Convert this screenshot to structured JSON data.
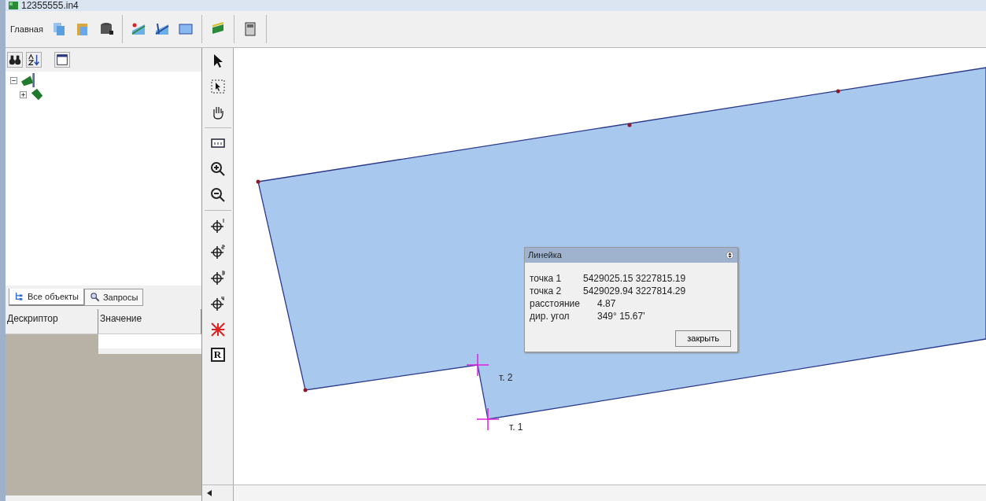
{
  "window": {
    "title": "12355555.in4"
  },
  "toolbar": {
    "label": "Главная"
  },
  "tree": [
    {
      "expanded": true,
      "children": [
        {
          "expanded": false
        }
      ]
    }
  ],
  "tabs": [
    {
      "label": "Все объекты",
      "selected": true
    },
    {
      "label": "Запросы",
      "selected": false
    }
  ],
  "properties": {
    "columns": [
      "Дескриптор",
      "Значение"
    ]
  },
  "tools": {
    "r_button": "R"
  },
  "map": {
    "point_labels": [
      "т. 2",
      "т. 1"
    ]
  },
  "ruler_dialog": {
    "title": "Линейка",
    "rows": [
      {
        "label": "точка 1",
        "value": "5429025.15 3227815.19"
      },
      {
        "label": "точка 2",
        "value": "5429029.94 3227814.29"
      },
      {
        "label": "расстояние",
        "value": "4.87"
      },
      {
        "label": "дир. угол",
        "value": "349° 15.67'"
      }
    ],
    "close_button": "закрыть"
  }
}
